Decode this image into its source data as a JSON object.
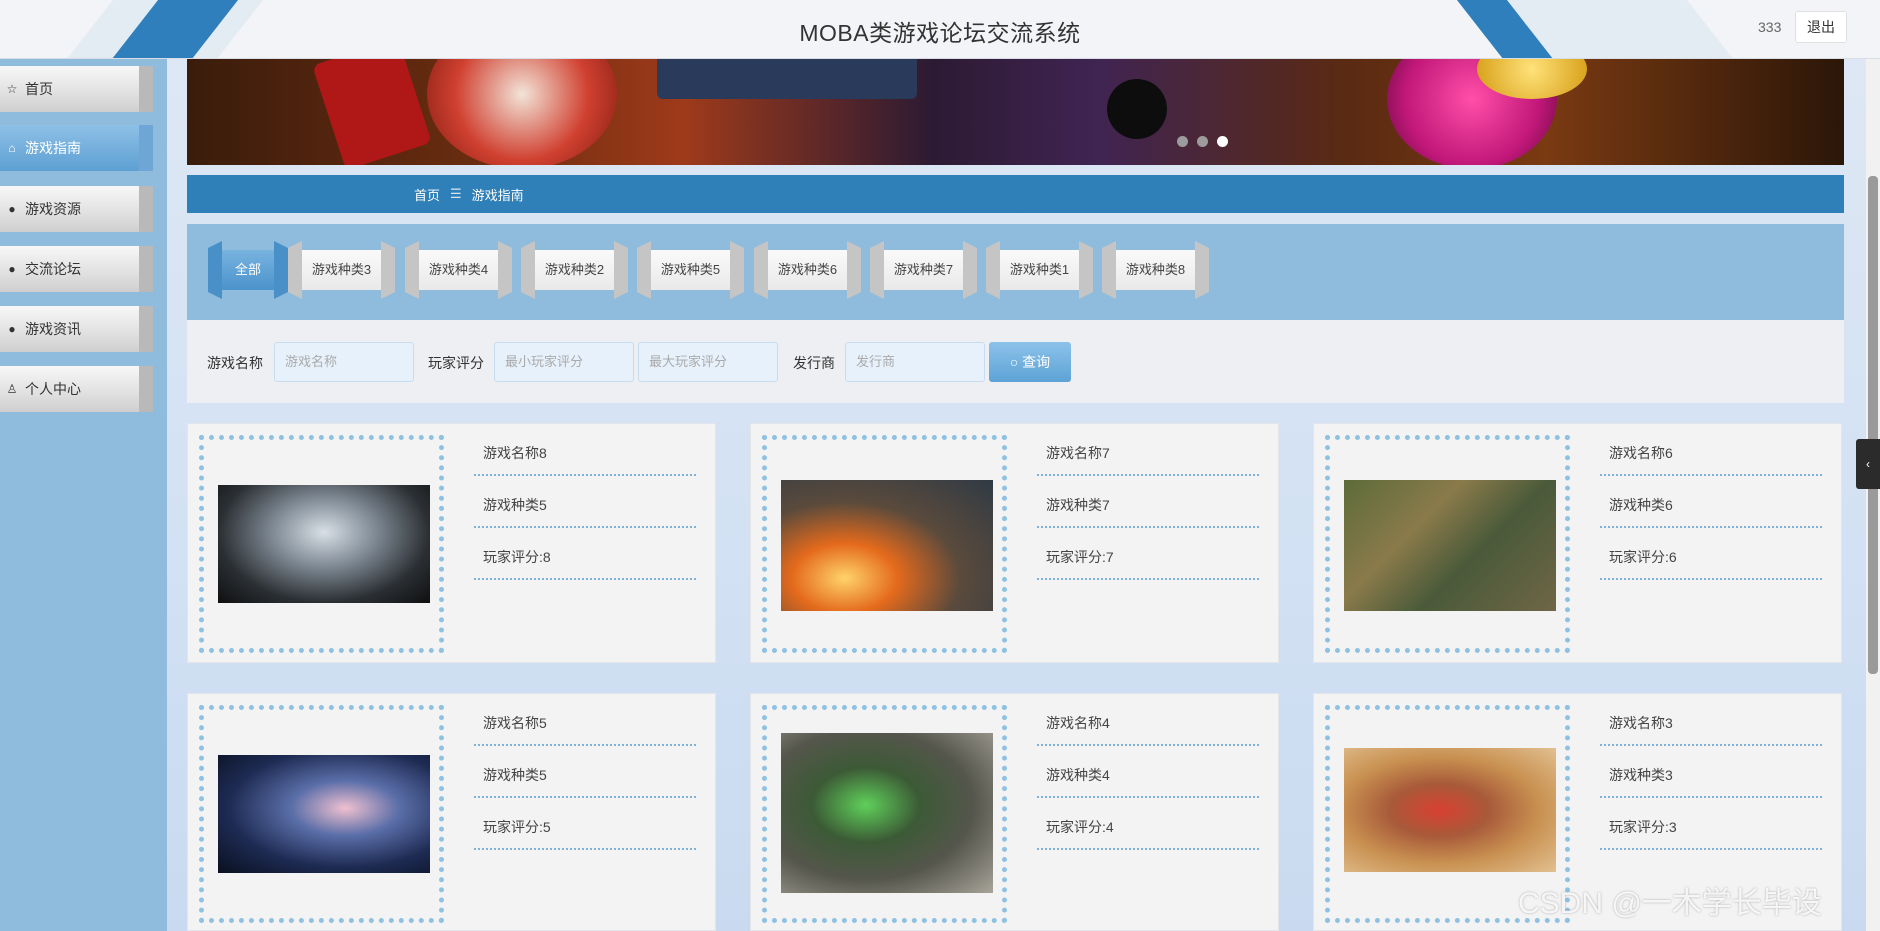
{
  "header": {
    "title": "MOBA类游戏论坛交流系统",
    "username": "333",
    "logout_label": "退出"
  },
  "sidebar": {
    "items": [
      {
        "label": "首页",
        "icon": "star-icon"
      },
      {
        "label": "游戏指南",
        "icon": "bag-icon"
      },
      {
        "label": "游戏资源",
        "icon": "exclamation-icon"
      },
      {
        "label": "交流论坛",
        "icon": "question-icon"
      },
      {
        "label": "游戏资讯",
        "icon": "info-icon"
      },
      {
        "label": "个人中心",
        "icon": "user-icon"
      }
    ],
    "active_index": 1
  },
  "banner": {
    "slides": 3,
    "active_slide": 3
  },
  "breadcrumb": {
    "home": "首页",
    "separator": "☰",
    "current": "游戏指南"
  },
  "categories": [
    "全部",
    "游戏种类3",
    "游戏种类4",
    "游戏种类2",
    "游戏种类5",
    "游戏种类6",
    "游戏种类7",
    "游戏种类1",
    "游戏种类8"
  ],
  "search": {
    "name_label": "游戏名称",
    "name_placeholder": "游戏名称",
    "rating_label": "玩家评分",
    "min_placeholder": "最小玩家评分",
    "max_placeholder": "最大玩家评分",
    "publisher_label": "发行商",
    "publisher_placeholder": "发行商",
    "button_label": "查询"
  },
  "games": [
    {
      "name": "游戏名称8",
      "category": "游戏种类5",
      "rating": "玩家评分:8"
    },
    {
      "name": "游戏名称7",
      "category": "游戏种类7",
      "rating": "玩家评分:7"
    },
    {
      "name": "游戏名称6",
      "category": "游戏种类6",
      "rating": "玩家评分:6"
    },
    {
      "name": "游戏名称5",
      "category": "游戏种类5",
      "rating": "玩家评分:5"
    },
    {
      "name": "游戏名称4",
      "category": "游戏种类4",
      "rating": "玩家评分:4"
    },
    {
      "name": "游戏名称3",
      "category": "游戏种类3",
      "rating": "玩家评分:3"
    }
  ],
  "watermark": "CSDN @一木学长毕设",
  "colors": {
    "accent": "#2f7fb8",
    "sidebar_bg": "#8fbbdc",
    "active_tab": "#4b93cb"
  }
}
